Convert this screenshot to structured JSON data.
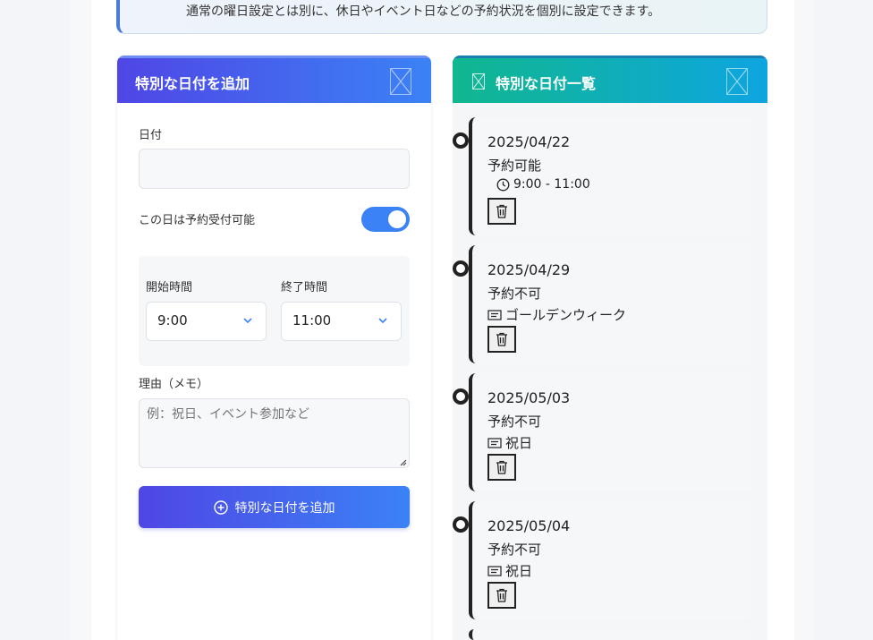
{
  "info_banner": {
    "text": "通常の曜日設定とは別に、休日やイベント日などの予約状況を個別に設定できます。"
  },
  "add_card": {
    "title": "特別な日付を追加",
    "date_label": "日付",
    "date_value": "",
    "toggle_label": "この日は予約受付可能",
    "toggle_on": true,
    "start_label": "開始時間",
    "start_value": "9:00",
    "end_label": "終了時間",
    "end_value": "11:00",
    "memo_label": "理由（メモ）",
    "memo_placeholder": "例：祝日、イベント参加など",
    "submit_label": "特別な日付を追加"
  },
  "list_card": {
    "title": "特別な日付一覧",
    "items": [
      {
        "date": "2025/04/22",
        "status": "予約可能",
        "time": "9:00 - 11:00"
      },
      {
        "date": "2025/04/29",
        "status": "予約不可",
        "note": "ゴールデンウィーク"
      },
      {
        "date": "2025/05/03",
        "status": "予約不可",
        "note": "祝日"
      },
      {
        "date": "2025/05/04",
        "status": "予約不可",
        "note": "祝日"
      }
    ]
  },
  "colors": {
    "add_header_start": "#4f46e5",
    "add_header_end": "#3b82f6",
    "list_header_start": "#10b78f",
    "list_header_end": "#0ea5e0",
    "toggle_on": "#3b82f6"
  }
}
